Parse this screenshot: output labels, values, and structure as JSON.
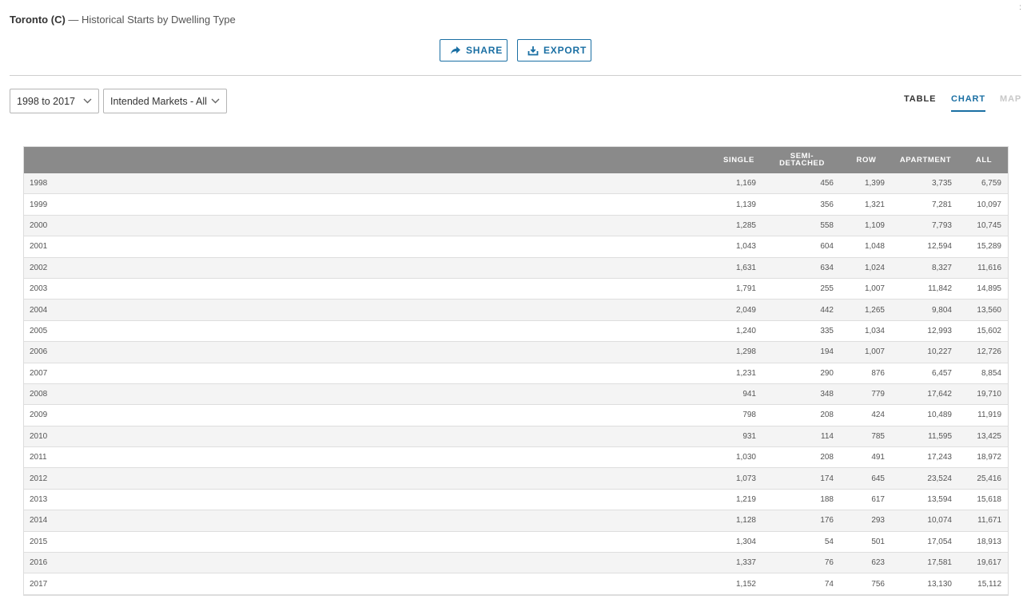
{
  "header": {
    "title_bold": "Toronto (C)",
    "title_rest": " — Historical Starts by Dwelling Type"
  },
  "actions": {
    "share_label": "SHARE",
    "export_label": "EXPORT",
    "share_icon": "share-arrow-icon",
    "export_icon": "download-tray-icon"
  },
  "filters": {
    "years": "1998 to 2017",
    "markets": "Intended Markets - All"
  },
  "view_tabs": [
    {
      "label": "TABLE",
      "state": "default"
    },
    {
      "label": "CHART",
      "state": "active"
    },
    {
      "label": "MAP",
      "state": "disabled"
    }
  ],
  "colors": {
    "accent": "#1a6fa3",
    "header_bg": "#8a8a8a",
    "row_alt": "#f4f4f4"
  },
  "table": {
    "columns": [
      "",
      "SINGLE",
      "SEMI-\nDETACHED",
      "ROW",
      "APARTMENT",
      "ALL"
    ],
    "rows": [
      [
        "1998",
        "1,169",
        "456",
        "1,399",
        "3,735",
        "6,759"
      ],
      [
        "1999",
        "1,139",
        "356",
        "1,321",
        "7,281",
        "10,097"
      ],
      [
        "2000",
        "1,285",
        "558",
        "1,109",
        "7,793",
        "10,745"
      ],
      [
        "2001",
        "1,043",
        "604",
        "1,048",
        "12,594",
        "15,289"
      ],
      [
        "2002",
        "1,631",
        "634",
        "1,024",
        "8,327",
        "11,616"
      ],
      [
        "2003",
        "1,791",
        "255",
        "1,007",
        "11,842",
        "14,895"
      ],
      [
        "2004",
        "2,049",
        "442",
        "1,265",
        "9,804",
        "13,560"
      ],
      [
        "2005",
        "1,240",
        "335",
        "1,034",
        "12,993",
        "15,602"
      ],
      [
        "2006",
        "1,298",
        "194",
        "1,007",
        "10,227",
        "12,726"
      ],
      [
        "2007",
        "1,231",
        "290",
        "876",
        "6,457",
        "8,854"
      ],
      [
        "2008",
        "941",
        "348",
        "779",
        "17,642",
        "19,710"
      ],
      [
        "2009",
        "798",
        "208",
        "424",
        "10,489",
        "11,919"
      ],
      [
        "2010",
        "931",
        "114",
        "785",
        "11,595",
        "13,425"
      ],
      [
        "2011",
        "1,030",
        "208",
        "491",
        "17,243",
        "18,972"
      ],
      [
        "2012",
        "1,073",
        "174",
        "645",
        "23,524",
        "25,416"
      ],
      [
        "2013",
        "1,219",
        "188",
        "617",
        "13,594",
        "15,618"
      ],
      [
        "2014",
        "1,128",
        "176",
        "293",
        "10,074",
        "11,671"
      ],
      [
        "2015",
        "1,304",
        "54",
        "501",
        "17,054",
        "18,913"
      ],
      [
        "2016",
        "1,337",
        "76",
        "623",
        "17,581",
        "19,617"
      ],
      [
        "2017",
        "1,152",
        "74",
        "756",
        "13,130",
        "15,112"
      ]
    ]
  }
}
